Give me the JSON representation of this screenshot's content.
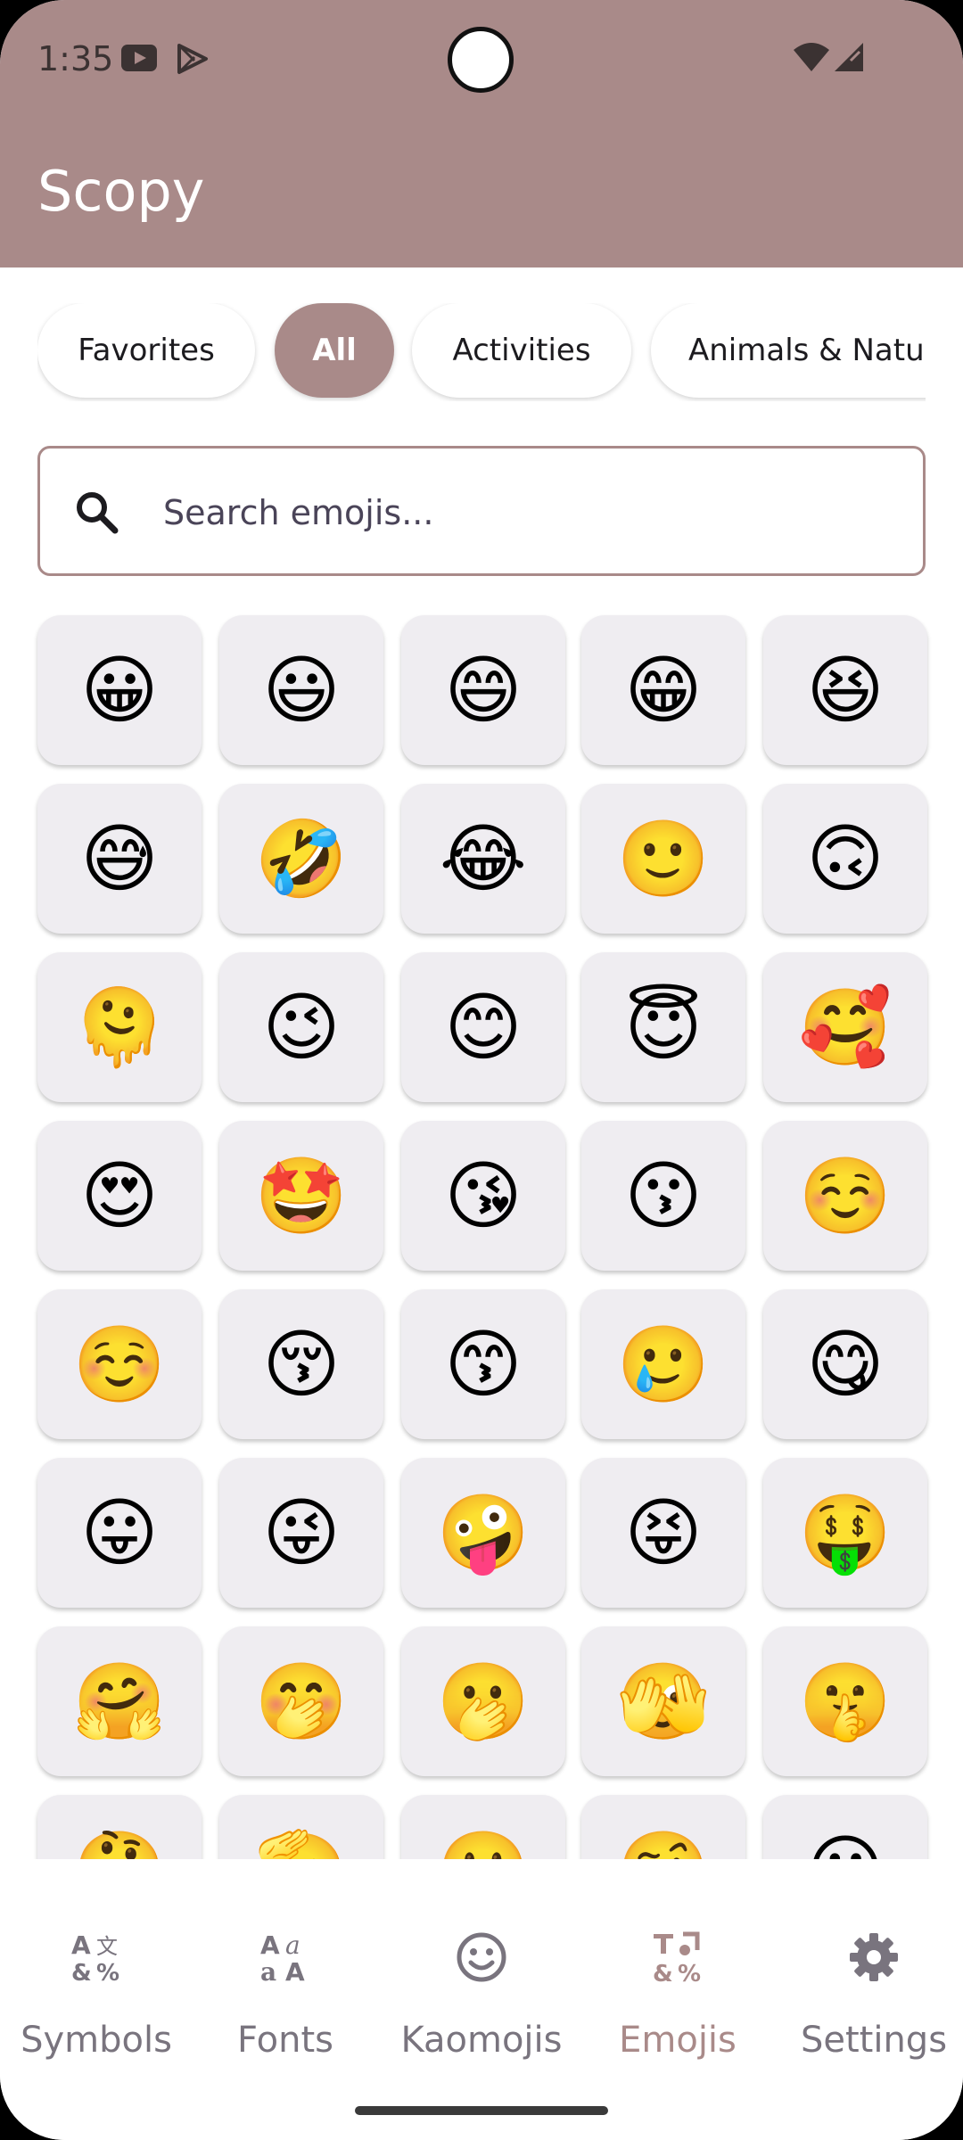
{
  "status_bar": {
    "time": "1:35",
    "icons": [
      "youtube-icon",
      "play-store-icon",
      "wifi-icon",
      "signal-icon"
    ]
  },
  "app_bar": {
    "title": "Scopy",
    "color": "#a98a89"
  },
  "categories": [
    "Favorites",
    "All",
    "Activities",
    "Animals & Natu"
  ],
  "selected_category": "All",
  "search": {
    "placeholder": "Search emojis..."
  },
  "emojis": [
    "😀",
    "😃",
    "😄",
    "😁",
    "😆",
    "😅",
    "🤣",
    "😂",
    "🙂",
    "🙃",
    "🫠",
    "😉",
    "😊",
    "😇",
    "🥰",
    "😍",
    "🤩",
    "😘",
    "😗",
    "☺️",
    "☺️",
    "😚",
    "😙",
    "🥲",
    "😋",
    "😛",
    "😜",
    "🤪",
    "😝",
    "🤑",
    "🤗",
    "🤭",
    "🫢",
    "🫣",
    "🤫",
    "🤔",
    "🫡",
    "🤐",
    "🤨",
    "😐"
  ],
  "bottom_nav": [
    {
      "label": "Symbols",
      "icon": "translate-icon",
      "active": false
    },
    {
      "label": "Fonts",
      "icon": "font-style-icon",
      "active": false
    },
    {
      "label": "Kaomojis",
      "icon": "smiley-icon",
      "active": false
    },
    {
      "label": "Emojis",
      "icon": "emoji-symbols-icon",
      "active": true
    },
    {
      "label": "Settings",
      "icon": "gear-icon",
      "active": false
    }
  ],
  "accent_color": "#a98a89"
}
